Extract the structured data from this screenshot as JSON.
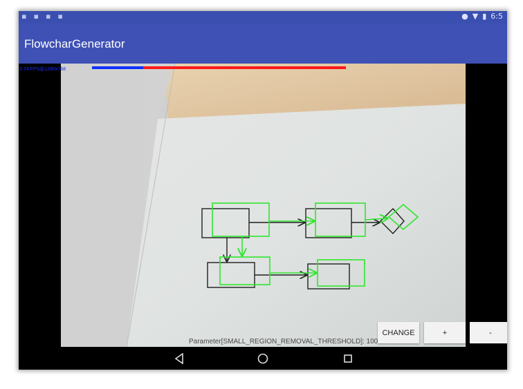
{
  "status_bar": {
    "time": "6:5"
  },
  "app_bar": {
    "title": "FlowcharGenerator"
  },
  "camera": {
    "fps_text": "0.74 FPS@1280x768",
    "parameter_text": "Parameter[SMALL_REGION_REMOVAL_THRESHOLD]: 100"
  },
  "buttons": {
    "change": "CHANGE",
    "plus": "+",
    "minus": "-"
  },
  "colors": {
    "appbar": "#3f51b5",
    "detection_box": "#2ee62e",
    "progress_blue": "#1030ff",
    "progress_red": "#ff1a1a"
  },
  "icons": {
    "nav_back": "back-triangle-icon",
    "nav_home": "home-circle-icon",
    "nav_recent": "recent-square-icon"
  }
}
